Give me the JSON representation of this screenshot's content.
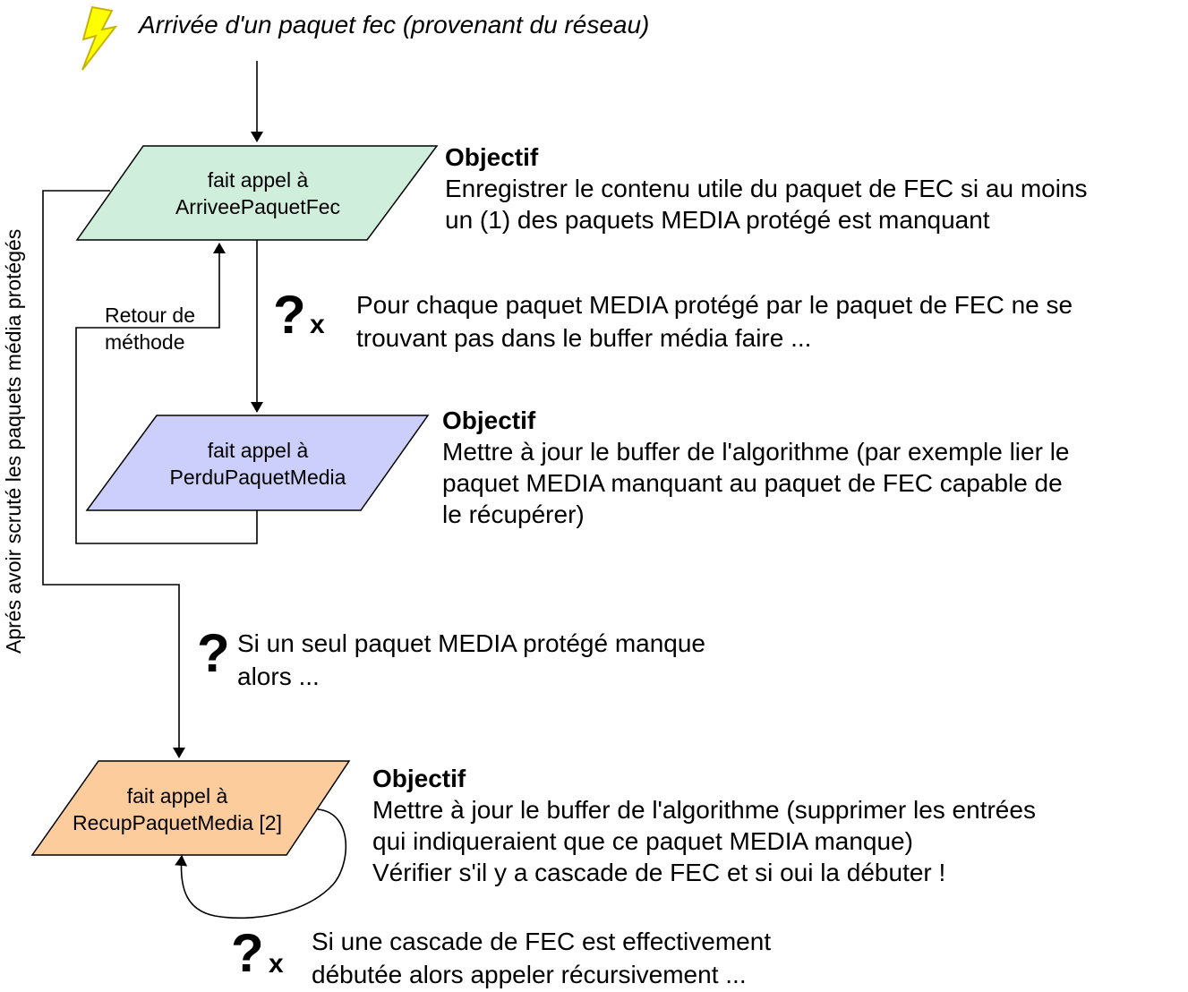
{
  "event": {
    "icon": "lightning-bolt-icon",
    "text": "Arrivée d'un paquet fec (provenant du réseau)"
  },
  "colors": {
    "arrivee_fill": "#cfeedc",
    "perdu_fill": "#cccefc",
    "recup_fill": "#fdcc9d",
    "bolt_fill": "#ffff00"
  },
  "nodes": {
    "arrivee": {
      "line1": "fait appel à",
      "line2": "ArriveePaquetFec"
    },
    "perdu": {
      "line1": "fait appel à",
      "line2": "PerduPaquetMedia"
    },
    "recup": {
      "line1": "fait appel à",
      "line2": "RecupPaquetMedia [2]"
    }
  },
  "objectives": {
    "arrivee": {
      "heading": "Objectif",
      "lines": [
        "Enregistrer le contenu utile du paquet de FEC si au moins",
        "un (1) des paquets MEDIA protégé est manquant"
      ]
    },
    "perdu": {
      "heading": "Objectif",
      "lines": [
        "Mettre à jour le buffer de l'algorithme (par exemple lier le",
        "paquet MEDIA manquant au paquet de FEC capable de",
        "le récupérer)"
      ]
    },
    "recup": {
      "heading": "Objectif",
      "lines": [
        "Mettre à jour le buffer de l'algorithme (supprimer les entrées",
        "qui indiqueraient que ce paquet MEDIA manque)",
        "Vérifier s'il y a cascade de FEC et si oui la débuter !"
      ]
    }
  },
  "conditions": {
    "loop_media": {
      "symbol": "?",
      "suffix": "x",
      "lines": [
        "Pour chaque paquet MEDIA protégé par le paquet de FEC ne se",
        "trouvant pas dans le buffer média faire ..."
      ]
    },
    "single_missing": {
      "symbol": "?",
      "lines": [
        "Si un seul paquet MEDIA protégé manque",
        "alors ..."
      ]
    },
    "cascade": {
      "symbol": "?",
      "suffix": "x",
      "lines": [
        "Si une cascade de FEC est effectivement",
        "débutée alors appeler récursivement ..."
      ]
    }
  },
  "labels": {
    "return_line1": "Retour de",
    "return_line2": "méthode",
    "vertical": "Aprés avoir scruté les paquets média protégés"
  }
}
